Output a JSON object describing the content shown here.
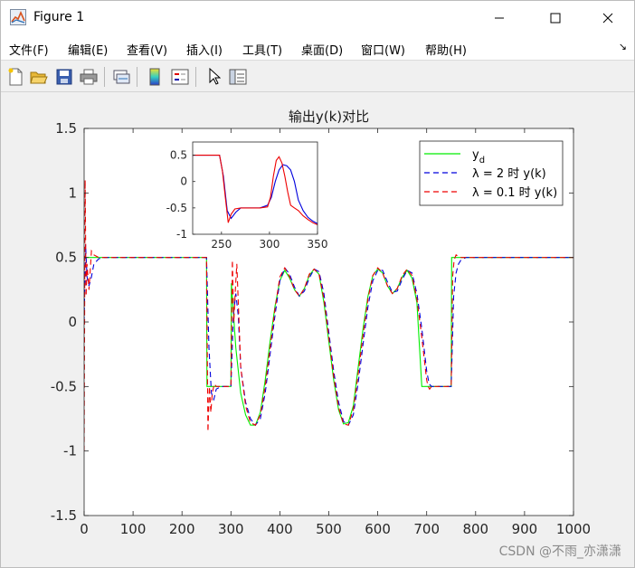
{
  "window": {
    "title": "Figure 1",
    "minimize_glyph": "—",
    "close_glyph": "✕"
  },
  "menu": {
    "items": [
      "文件(F)",
      "编辑(E)",
      "查看(V)",
      "插入(I)",
      "工具(T)",
      "桌面(D)",
      "窗口(W)",
      "帮助(H)"
    ],
    "dock_glyph": "↘"
  },
  "toolbar": {
    "icons": [
      "new-figure-icon",
      "open-file-icon",
      "save-icon",
      "print-icon",
      "link-plot-icon",
      "colorbar-icon",
      "legend-icon",
      "pointer-icon",
      "property-editor-icon"
    ]
  },
  "watermark": "CSDN @不雨_亦潇潇",
  "chart_data": {
    "type": "line",
    "title": "输出y(k)对比",
    "xlim": [
      0,
      1000
    ],
    "ylim": [
      -1.5,
      1.5
    ],
    "xticks": [
      0,
      100,
      200,
      300,
      400,
      500,
      600,
      700,
      800,
      900,
      1000
    ],
    "yticks": [
      -1.5,
      -1,
      -0.5,
      0,
      0.5,
      1,
      1.5
    ],
    "ytick_labels": [
      "-1.5",
      "-1",
      "-0.5",
      "0",
      "0.5",
      "1",
      "1.5"
    ],
    "grid": false,
    "legend_position": "top-right",
    "series": [
      {
        "name": "y",
        "name_sub": "d",
        "color": "#00ee00",
        "dash": "solid",
        "x": [
          0,
          10,
          20,
          30,
          40,
          250,
          251,
          300,
          301,
          310,
          320,
          330,
          340,
          350,
          360,
          370,
          380,
          390,
          400,
          410,
          420,
          430,
          440,
          450,
          460,
          470,
          480,
          490,
          500,
          510,
          520,
          530,
          540,
          550,
          560,
          570,
          580,
          590,
          600,
          610,
          620,
          630,
          640,
          650,
          660,
          670,
          680,
          690,
          700,
          701,
          750,
          751,
          760,
          800,
          900,
          1000
        ],
        "y": [
          0.5,
          0.5,
          0.5,
          0.5,
          0.5,
          0.5,
          -0.5,
          -0.5,
          0.3,
          -0.2,
          -0.55,
          -0.72,
          -0.8,
          -0.8,
          -0.7,
          -0.45,
          -0.15,
          0.12,
          0.32,
          0.4,
          0.34,
          0.25,
          0.2,
          0.26,
          0.36,
          0.41,
          0.37,
          0.15,
          -0.15,
          -0.45,
          -0.68,
          -0.79,
          -0.78,
          -0.65,
          -0.35,
          -0.05,
          0.2,
          0.36,
          0.41,
          0.38,
          0.28,
          0.22,
          0.26,
          0.35,
          0.4,
          0.34,
          0.15,
          -0.5,
          -0.5,
          -0.5,
          -0.5,
          0.5,
          0.5,
          0.5,
          0.5,
          0.5
        ]
      },
      {
        "name": "λ = 2 时 y(k)",
        "color": "#0000dd",
        "dash": "6,4",
        "x": [
          0,
          3,
          6,
          10,
          15,
          20,
          30,
          40,
          250,
          255,
          260,
          265,
          270,
          280,
          300,
          305,
          310,
          315,
          320,
          330,
          340,
          350,
          360,
          370,
          380,
          390,
          400,
          410,
          420,
          430,
          440,
          450,
          460,
          470,
          480,
          490,
          500,
          510,
          520,
          530,
          540,
          550,
          560,
          570,
          580,
          590,
          600,
          610,
          620,
          630,
          640,
          650,
          660,
          670,
          680,
          690,
          700,
          705,
          710,
          720,
          730,
          740,
          750,
          755,
          760,
          765,
          770,
          780,
          800,
          900,
          1000
        ],
        "y": [
          0.0,
          0.6,
          0.35,
          0.28,
          0.35,
          0.45,
          0.49,
          0.5,
          0.5,
          -0.2,
          -0.55,
          -0.6,
          -0.52,
          -0.5,
          -0.5,
          0.05,
          0.22,
          0.05,
          -0.35,
          -0.62,
          -0.75,
          -0.8,
          -0.75,
          -0.55,
          -0.25,
          0.05,
          0.32,
          0.42,
          0.37,
          0.27,
          0.2,
          0.24,
          0.34,
          0.41,
          0.39,
          0.22,
          -0.08,
          -0.38,
          -0.62,
          -0.77,
          -0.8,
          -0.72,
          -0.47,
          -0.17,
          0.12,
          0.32,
          0.4,
          0.4,
          0.31,
          0.23,
          0.24,
          0.33,
          0.4,
          0.38,
          0.22,
          -0.05,
          -0.38,
          -0.48,
          -0.5,
          -0.5,
          -0.5,
          -0.5,
          -0.5,
          0.2,
          0.38,
          0.45,
          0.48,
          0.5,
          0.5,
          0.5,
          0.5
        ]
      },
      {
        "name": "λ = 0.1 时 y(k)",
        "color": "#ee0000",
        "dash": "6,4",
        "x": [
          0,
          2,
          4,
          6,
          10,
          15,
          20,
          30,
          40,
          250,
          253,
          256,
          259,
          262,
          266,
          270,
          280,
          300,
          303,
          306,
          309,
          312,
          316,
          320,
          330,
          340,
          350,
          360,
          370,
          380,
          390,
          400,
          410,
          420,
          430,
          440,
          450,
          460,
          470,
          480,
          490,
          500,
          510,
          520,
          530,
          540,
          550,
          560,
          570,
          580,
          590,
          600,
          610,
          620,
          630,
          640,
          650,
          660,
          670,
          680,
          690,
          700,
          703,
          706,
          710,
          720,
          740,
          750,
          753,
          756,
          760,
          770,
          780,
          800,
          900,
          1000
        ],
        "y": [
          -1.0,
          1.1,
          0.2,
          0.45,
          0.25,
          0.55,
          0.52,
          0.5,
          0.5,
          0.5,
          -0.85,
          -0.5,
          -0.7,
          -0.55,
          -0.48,
          -0.5,
          -0.5,
          -0.5,
          0.48,
          0.0,
          0.25,
          0.45,
          0.05,
          -0.35,
          -0.65,
          -0.78,
          -0.8,
          -0.72,
          -0.5,
          -0.2,
          0.1,
          0.35,
          0.42,
          0.35,
          0.25,
          0.2,
          0.26,
          0.37,
          0.41,
          0.37,
          0.18,
          -0.12,
          -0.42,
          -0.66,
          -0.79,
          -0.8,
          -0.68,
          -0.4,
          -0.1,
          0.18,
          0.36,
          0.42,
          0.38,
          0.28,
          0.22,
          0.26,
          0.36,
          0.41,
          0.36,
          0.18,
          -0.12,
          -0.45,
          -0.5,
          -0.52,
          -0.5,
          -0.5,
          -0.5,
          -0.5,
          0.35,
          0.48,
          0.52,
          0.5,
          0.5,
          0.5,
          0.5,
          0.5
        ]
      }
    ],
    "inset": {
      "xlim": [
        220,
        350
      ],
      "ylim": [
        -1,
        0.75
      ],
      "xticks": [
        250,
        300,
        350
      ],
      "yticks": [
        -1,
        -0.5,
        0,
        0.5
      ],
      "ytick_labels": [
        "-1",
        "-0.5",
        "0",
        "0.5"
      ],
      "series": [
        {
          "color": "#0000dd",
          "x": [
            220,
            240,
            248,
            252,
            256,
            260,
            265,
            270,
            280,
            290,
            298,
            302,
            306,
            310,
            314,
            318,
            322,
            326,
            330,
            335,
            340,
            345,
            350
          ],
          "y": [
            0.5,
            0.5,
            0.5,
            0.1,
            -0.55,
            -0.7,
            -0.58,
            -0.5,
            -0.5,
            -0.5,
            -0.45,
            -0.3,
            0.0,
            0.22,
            0.32,
            0.3,
            0.22,
            0.0,
            -0.35,
            -0.55,
            -0.68,
            -0.75,
            -0.8
          ]
        },
        {
          "color": "#ee0000",
          "x": [
            220,
            240,
            248,
            251,
            254,
            257,
            260,
            264,
            270,
            280,
            290,
            298,
            301,
            304,
            307,
            310,
            313,
            316,
            319,
            322,
            326,
            330,
            335,
            340,
            345,
            350
          ],
          "y": [
            0.5,
            0.5,
            0.5,
            0.2,
            -0.3,
            -0.78,
            -0.62,
            -0.52,
            -0.5,
            -0.5,
            -0.5,
            -0.48,
            -0.3,
            0.1,
            0.4,
            0.47,
            0.35,
            0.1,
            -0.2,
            -0.45,
            -0.5,
            -0.55,
            -0.65,
            -0.72,
            -0.78,
            -0.82
          ]
        }
      ]
    }
  }
}
